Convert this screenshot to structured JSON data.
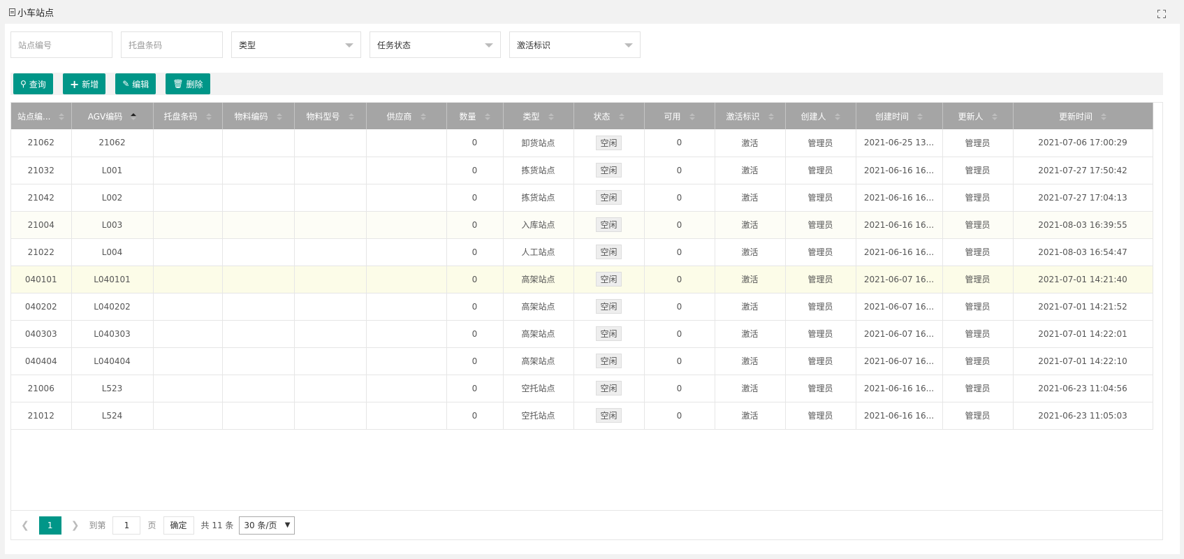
{
  "header": {
    "title": "小车站点"
  },
  "filters": {
    "station_code_placeholder": "站点编号",
    "pallet_code_placeholder": "托盘条码",
    "type_label": "类型",
    "task_status_label": "任务状态",
    "active_flag_label": "激活标识"
  },
  "toolbar": {
    "query": "查询",
    "add": "新增",
    "edit": "编辑",
    "delete": "删除"
  },
  "table": {
    "columns": [
      "站点编...",
      "AGV编码",
      "托盘条码",
      "物料编码",
      "物料型号",
      "供应商",
      "数量",
      "类型",
      "状态",
      "可用",
      "激活标识",
      "创建人",
      "创建时间",
      "更新人",
      "更新时间"
    ],
    "rows": [
      [
        "21062",
        "21062",
        "",
        "",
        "",
        "",
        "0",
        "卸货站点",
        "空闲",
        "0",
        "激活",
        "管理员",
        "2021-06-25 13...",
        "管理员",
        "2021-07-06 17:00:29"
      ],
      [
        "21032",
        "L001",
        "",
        "",
        "",
        "",
        "0",
        "拣货站点",
        "空闲",
        "0",
        "激活",
        "管理员",
        "2021-06-16 16...",
        "管理员",
        "2021-07-27 17:50:42"
      ],
      [
        "21042",
        "L002",
        "",
        "",
        "",
        "",
        "0",
        "拣货站点",
        "空闲",
        "0",
        "激活",
        "管理员",
        "2021-06-16 16...",
        "管理员",
        "2021-07-27 17:04:13"
      ],
      [
        "21004",
        "L003",
        "",
        "",
        "",
        "",
        "0",
        "入库站点",
        "空闲",
        "0",
        "激活",
        "管理员",
        "2021-06-16 16...",
        "管理员",
        "2021-08-03 16:39:55"
      ],
      [
        "21022",
        "L004",
        "",
        "",
        "",
        "",
        "0",
        "人工站点",
        "空闲",
        "0",
        "激活",
        "管理员",
        "2021-06-16 16...",
        "管理员",
        "2021-08-03 16:54:47"
      ],
      [
        "040101",
        "L040101",
        "",
        "",
        "",
        "",
        "0",
        "高架站点",
        "空闲",
        "0",
        "激活",
        "管理员",
        "2021-06-07 16...",
        "管理员",
        "2021-07-01 14:21:40"
      ],
      [
        "040202",
        "L040202",
        "",
        "",
        "",
        "",
        "0",
        "高架站点",
        "空闲",
        "0",
        "激活",
        "管理员",
        "2021-06-07 16...",
        "管理员",
        "2021-07-01 14:21:52"
      ],
      [
        "040303",
        "L040303",
        "",
        "",
        "",
        "",
        "0",
        "高架站点",
        "空闲",
        "0",
        "激活",
        "管理员",
        "2021-06-07 16...",
        "管理员",
        "2021-07-01 14:22:01"
      ],
      [
        "040404",
        "L040404",
        "",
        "",
        "",
        "",
        "0",
        "高架站点",
        "空闲",
        "0",
        "激活",
        "管理员",
        "2021-06-07 16...",
        "管理员",
        "2021-07-01 14:22:10"
      ],
      [
        "21006",
        "L523",
        "",
        "",
        "",
        "",
        "0",
        "空托站点",
        "空闲",
        "0",
        "激活",
        "管理员",
        "2021-06-16 16...",
        "管理员",
        "2021-06-23 11:04:56"
      ],
      [
        "21012",
        "L524",
        "",
        "",
        "",
        "",
        "0",
        "空托站点",
        "空闲",
        "0",
        "激活",
        "管理员",
        "2021-06-16 16...",
        "管理员",
        "2021-06-23 11:05:03"
      ]
    ]
  },
  "pager": {
    "current_page": "1",
    "goto_label": "到第",
    "page_input": "1",
    "page_unit": "页",
    "confirm": "确定",
    "total": "共 11 条",
    "page_size": "30 条/页"
  },
  "colors": {
    "accent": "#009688",
    "header_bg": "#a5a5a5"
  }
}
